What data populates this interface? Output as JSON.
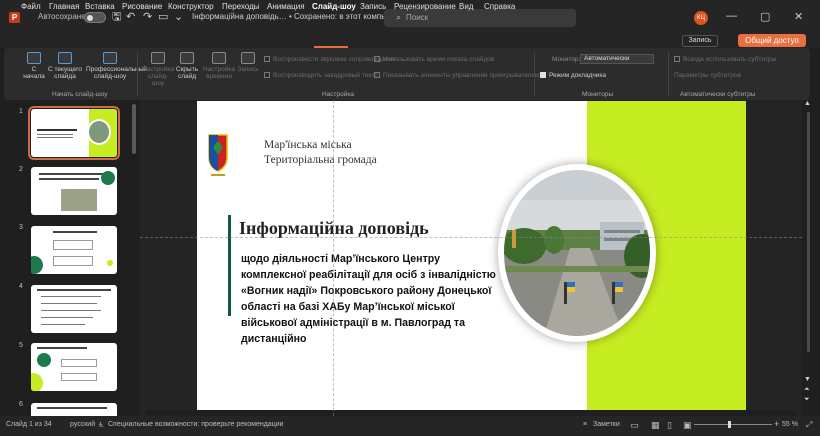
{
  "titlebar": {
    "app_logo": "P",
    "autosave_label": "Автосохранение",
    "autosave_state": "off",
    "doc_title": "Інформаційна доповідь… • Сохранено: в этот компьютер ⌄",
    "search_placeholder": "Поиск",
    "avatar_initials": "КЦ",
    "icons": [
      "save-icon",
      "undo-icon",
      "redo-icon",
      "present-icon",
      "customize-icon"
    ]
  },
  "menu": {
    "items": [
      "Файл",
      "Главная",
      "Вставка",
      "Рисование",
      "Конструктор",
      "Переходы",
      "Анимация",
      "Слайд-шоу",
      "Запись",
      "Рецензирование",
      "Вид",
      "Справка"
    ],
    "active": "Слайд-шоу",
    "record_label": "Запись",
    "share_label": "Общий доступ"
  },
  "ribbon": {
    "start": {
      "from_beginning": "С начала",
      "from_current": "С текущего слайда",
      "online": "Профессиональный слайд-шоу"
    },
    "setup": {
      "settings": "Настройка слайд-шоу",
      "hide": "Скрыть слайд",
      "timing": "Настройка времени",
      "record": "Запись"
    },
    "checks": [
      {
        "label": "Воспроизвести звуковое сопровождение",
        "on": false
      },
      {
        "label": "Воспроизводить закадровый текст",
        "on": false
      },
      {
        "label": "Использовать время показа слайдов",
        "on": false
      },
      {
        "label": "Показывать элементы управления проигрывателем",
        "on": false
      }
    ],
    "monitor_label": "Монитор:",
    "monitor_value": "Автоматически",
    "presenter_view": "Режим докладчика",
    "subtitles": "Всегда использовать субтитры",
    "subtitles_settings": "Параметры субтитров",
    "groups": [
      "Начать слайд-шоу",
      "Настройка",
      "Мониторы",
      "Автоматически субтитры"
    ]
  },
  "slides_panel": {
    "numbers": [
      "1",
      "2",
      "3",
      "4",
      "5",
      "6"
    ],
    "selected": "1"
  },
  "slide": {
    "logo_line1": "Мар'їнська міська",
    "logo_line2": "Територіальна громада",
    "heading": "Інформаційна доповідь",
    "body": "щодо діяльності Мар’їнського Центру комплексної реабілітації для осіб з інвалідністю «Вогник надії» Покровського району Донецької області на базі ХАБу Мар’їнської міської військової адміністрації в м. Павлоград та дистанційно",
    "colors": {
      "accent_green": "#c6ec22",
      "dark_green": "#0e5b37"
    }
  },
  "status": {
    "slide_counter": "Слайд 1 из 34",
    "language": "русский",
    "accessibility": "Специальные возможности: проверьте рекомендации",
    "notes": "Заметки",
    "zoom": "55 %"
  }
}
